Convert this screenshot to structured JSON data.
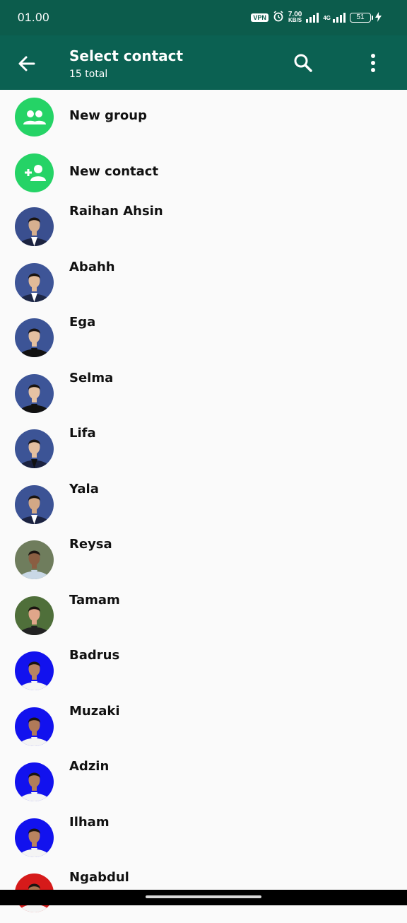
{
  "status_bar": {
    "time": "01.00",
    "vpn": "VPN",
    "speed_value": "7.00",
    "speed_unit": "KB/S",
    "network": "4G",
    "battery": "51"
  },
  "app_bar": {
    "title": "Select contact",
    "subtitle": "15 total"
  },
  "actions": [
    {
      "label": "New group",
      "icon": "group-icon"
    },
    {
      "label": "New contact",
      "icon": "add-person-icon"
    }
  ],
  "contacts": [
    {
      "name": "Raihan Ahsin",
      "bg": "#3a4f8f",
      "skin": "#d7b08f",
      "top": "#1c2340",
      "shirt": "#ffffff"
    },
    {
      "name": "Abahh",
      "bg": "#3e5597",
      "skin": "#e2bb98",
      "top": "#1d2745",
      "shirt": "#ffffff"
    },
    {
      "name": "Ega",
      "bg": "#3c5496",
      "skin": "#e4c0a0",
      "top": "#111111",
      "shirt": "#111111"
    },
    {
      "name": "Selma",
      "bg": "#3d5598",
      "skin": "#e6c3a4",
      "top": "#111111",
      "shirt": "#111111"
    },
    {
      "name": "Lifa",
      "bg": "#3c5496",
      "skin": "#e3bfa0",
      "top": "#1b2240",
      "shirt": "#111111"
    },
    {
      "name": "Yala",
      "bg": "#3c5395",
      "skin": "#d2a886",
      "top": "#1b2240",
      "shirt": "#ffffff"
    },
    {
      "name": "Reysa",
      "bg": "#6f7d5d",
      "skin": "#8a5e42",
      "top": "#c9d8e6",
      "shirt": "#c9d8e6"
    },
    {
      "name": "Tamam",
      "bg": "#4f6f3a",
      "skin": "#e0a68a",
      "top": "#222222",
      "shirt": "#222222"
    },
    {
      "name": "Badrus",
      "bg": "#1212ee",
      "skin": "#b98463",
      "top": "#f4f4f4",
      "shirt": "#f4f4f4"
    },
    {
      "name": "Muzaki",
      "bg": "#1212ee",
      "skin": "#b07a58",
      "top": "#f4f4f4",
      "shirt": "#f4f4f4"
    },
    {
      "name": "Adzin",
      "bg": "#1212ee",
      "skin": "#b27d5a",
      "top": "#f4f4f4",
      "shirt": "#f4f4f4"
    },
    {
      "name": "Ilham",
      "bg": "#1212ee",
      "skin": "#b8835f",
      "top": "#f4f4f4",
      "shirt": "#f4f4f4"
    },
    {
      "name": "Ngabdul",
      "bg": "#d61a1a",
      "skin": "#a8734f",
      "top": "#f4f4f4",
      "shirt": "#f4f4f4"
    }
  ],
  "colors": {
    "status_bar": "#0c5c4c",
    "app_bar": "#0b6152",
    "accent": "#25d366",
    "background": "#fafafa"
  }
}
